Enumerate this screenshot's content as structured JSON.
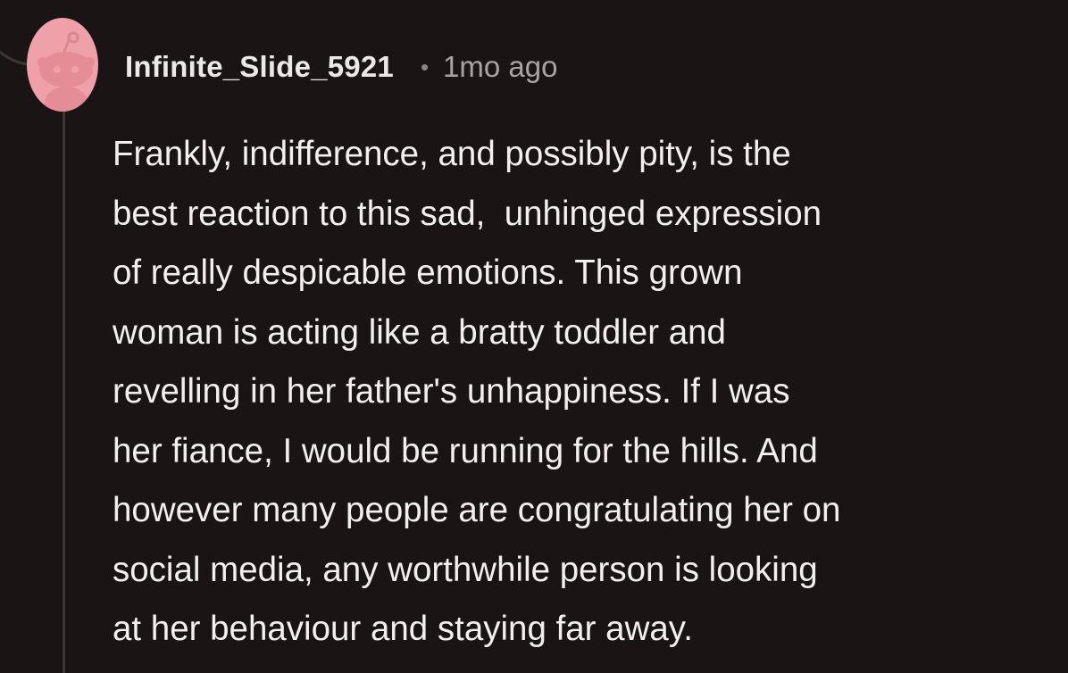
{
  "comment": {
    "author": "Infinite_Slide_5921",
    "separator": "•",
    "timestamp": "1mo ago",
    "body_lines": [
      "Frankly, indifference, and possibly pity, is the",
      "best reaction to this sad,  unhinged expression",
      "of really despicable emotions. This grown",
      "woman is acting like a bratty toddler and",
      "revelling in her father's unhappiness. If I was",
      "her fiance, I would be running for the hills. And",
      "however many people are congratulating her on",
      "social media, any worthwhile person is looking",
      "at her behaviour and staying far away."
    ]
  },
  "avatar": {
    "icon": "snoo-avatar-icon",
    "background_color": "#f0a0a8"
  },
  "colors": {
    "background": "#1a1514",
    "text": "#f2efee",
    "meta": "#aaa3a1",
    "thread_line": "#3b3533"
  }
}
